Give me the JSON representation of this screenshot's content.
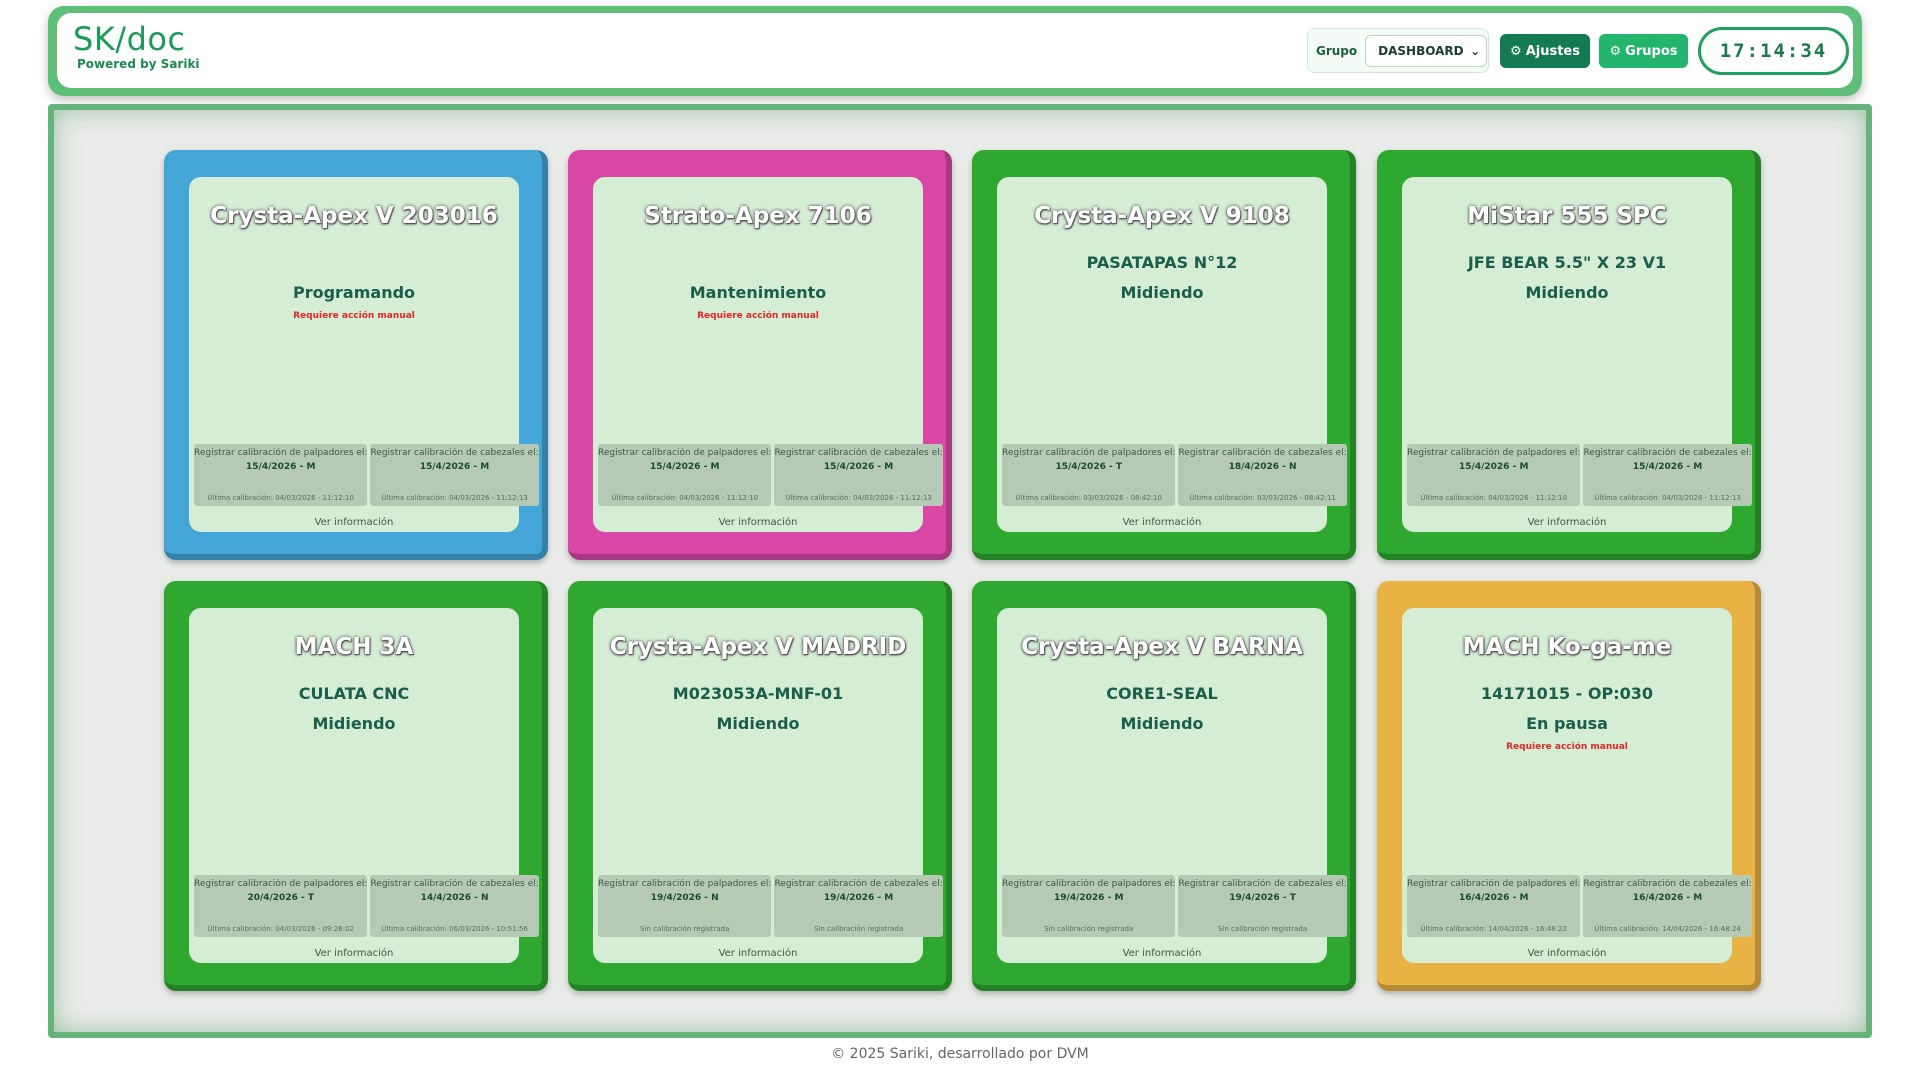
{
  "header": {
    "title": "SK/doc",
    "subtitle": "Powered by Sariki",
    "group_label": "Grupo",
    "group_selected": "DASHBOARD",
    "ajustes_label": "Ajustes",
    "grupos_label": "Grupos",
    "clock": "17:14:34"
  },
  "common": {
    "palpadores_label": "Registrar calibración de palpadores el:",
    "cabezales_label": "Registrar calibración de cabezales el:",
    "ver_info": "Ver información"
  },
  "machines": [
    {
      "name": "Crysta-Apex V 203016",
      "part": "",
      "status": "Programando",
      "alert": "Requiere acción manual",
      "color": "#43a6d6",
      "palp_date": "15/4/2026 - M",
      "palp_last": "Última calibración: 04/03/2026 - 11:12:10",
      "cab_date": "15/4/2026 - M",
      "cab_last": "Última calibración: 04/03/2026 - 11:12:13"
    },
    {
      "name": "Strato-Apex 7106",
      "part": "",
      "status": "Mantenimiento",
      "alert": "Requiere acción manual",
      "color": "#d847a6",
      "palp_date": "15/4/2026 - M",
      "palp_last": "Última calibración: 04/03/2026 - 11:12:10",
      "cab_date": "15/4/2026 - M",
      "cab_last": "Última calibración: 04/03/2026 - 11:12:13"
    },
    {
      "name": "Crysta-Apex V 9108",
      "part": "PASATAPAS N°12",
      "status": "Midiendo",
      "alert": "",
      "color": "#2ea82f",
      "palp_date": "15/4/2026 - T",
      "palp_last": "Última calibración: 03/03/2026 - 08:42:10",
      "cab_date": "18/4/2026 - N",
      "cab_last": "Última calibración: 03/03/2026 - 08:42:11"
    },
    {
      "name": "MiStar 555 SPC",
      "part": "JFE BEAR 5.5\" X 23 V1",
      "status": "Midiendo",
      "alert": "",
      "color": "#2ea82f",
      "palp_date": "15/4/2026 - M",
      "palp_last": "Última calibración: 04/03/2026 - 11:12:10",
      "cab_date": "15/4/2026 - M",
      "cab_last": "Última calibración: 04/03/2026 - 11:12:13"
    },
    {
      "name": "MACH 3A",
      "part": "CULATA CNC",
      "status": "Midiendo",
      "alert": "",
      "color": "#2ea82f",
      "palp_date": "20/4/2026 - T",
      "palp_last": "Última calibración: 04/03/2026 - 09:26:02",
      "cab_date": "14/4/2026 - N",
      "cab_last": "Última calibración: 06/03/2026 - 10:51:56"
    },
    {
      "name": "Crysta-Apex V MADRID",
      "part": "M023053A-MNF-01",
      "status": "Midiendo",
      "alert": "",
      "color": "#2ea82f",
      "palp_date": "19/4/2026 - N",
      "palp_last": "Sin calibración registrada",
      "cab_date": "19/4/2026 - M",
      "cab_last": "Sin calibración registrada"
    },
    {
      "name": "Crysta-Apex V BARNA",
      "part": "CORE1-SEAL",
      "status": "Midiendo",
      "alert": "",
      "color": "#2ea82f",
      "palp_date": "19/4/2026 - M",
      "palp_last": "Sin calibración registrada",
      "cab_date": "19/4/2026 - T",
      "cab_last": "Sin calibración registrada"
    },
    {
      "name": "MACH Ko-ga-me",
      "part": "14171015 - OP:030",
      "status": "En pausa",
      "alert": "Requiere acción manual",
      "color": "#e8b244",
      "palp_date": "16/4/2026 - M",
      "palp_last": "Última calibración: 14/04/2026 - 16:48:22",
      "cab_date": "16/4/2026 - M",
      "cab_last": "Última calibración: 14/04/2026 - 16:48:24"
    }
  ],
  "footer": "© 2025 Sariki, desarrollado por DVM",
  "colors": {
    "accent": "#1fa060",
    "ajustes": "#137a52",
    "grupos": "#22b56b",
    "card_inner": "#d5ecd5",
    "alert": "#e02828"
  }
}
